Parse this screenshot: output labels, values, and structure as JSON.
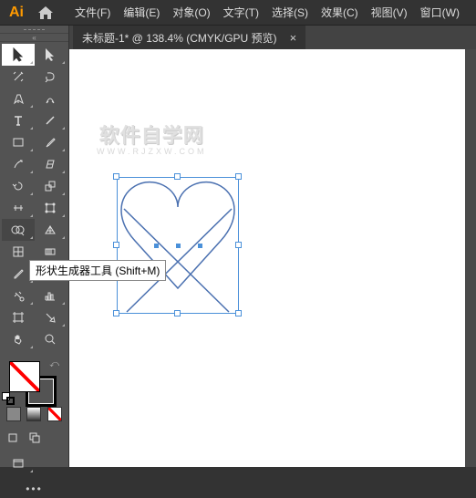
{
  "menu": {
    "file": "文件(F)",
    "edit": "编辑(E)",
    "object": "对象(O)",
    "type": "文字(T)",
    "select": "选择(S)",
    "effect": "效果(C)",
    "view": "视图(V)",
    "window": "窗口(W)"
  },
  "tab": {
    "title": "未标题-1* @ 138.4% (CMYK/GPU 预览)",
    "close": "×"
  },
  "tooltip": {
    "text": "形状生成器工具 (Shift+M)"
  },
  "watermark": {
    "main": "软件自学网",
    "sub": "WWW.RJZXW.COM"
  },
  "collapse_arrows": "«"
}
